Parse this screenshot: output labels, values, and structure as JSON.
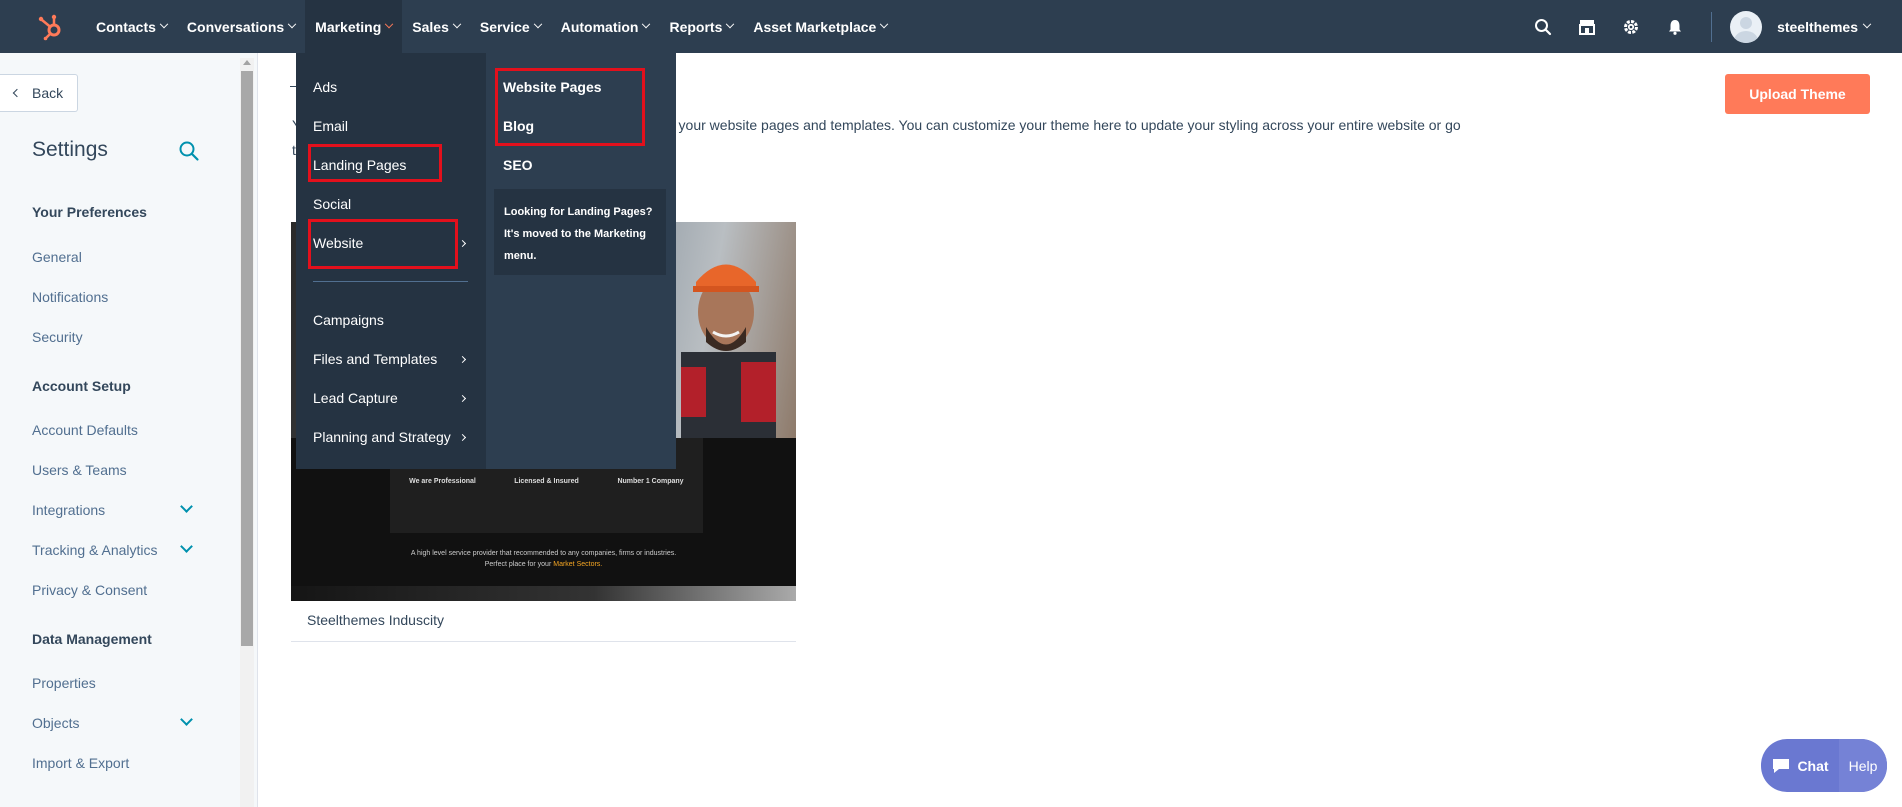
{
  "nav": {
    "items": [
      {
        "label": "Contacts"
      },
      {
        "label": "Conversations"
      },
      {
        "label": "Marketing"
      },
      {
        "label": "Sales"
      },
      {
        "label": "Service"
      },
      {
        "label": "Automation"
      },
      {
        "label": "Reports"
      },
      {
        "label": "Asset Marketplace"
      }
    ],
    "account_name": "steelthemes",
    "icons": [
      "search-icon",
      "marketplace-icon",
      "gear-icon",
      "bell-icon"
    ]
  },
  "sidebar": {
    "back_label": "Back",
    "title": "Settings",
    "sections": {
      "preferences": "Your Preferences",
      "account_setup": "Account Setup",
      "data_management": "Data Management"
    },
    "items": {
      "general": "General",
      "notifications": "Notifications",
      "security": "Security",
      "account_defaults": "Account Defaults",
      "users_teams": "Users & Teams",
      "integrations": "Integrations",
      "tracking": "Tracking & Analytics",
      "privacy": "Privacy & Consent",
      "properties": "Properties",
      "objects": "Objects",
      "import_export": "Import & Export"
    }
  },
  "main": {
    "upload_label": "Upload Theme",
    "desc_lead1": "Y",
    "desc_lead2": "t",
    "description": "r your website pages and templates. You can customize your theme here to update your styling across your entire website or go",
    "theme": {
      "name": "Steelthemes Induscity",
      "features": [
        "We are Professional",
        "Licensed & Insured",
        "Number 1 Company"
      ],
      "tagline_1": "A high level service provider that recommended to any companies, firms or industries.",
      "tagline_2_prefix": "Perfect place for your ",
      "tagline_2_highlight": "Market Sectors."
    }
  },
  "menu": {
    "left": {
      "ads": "Ads",
      "email": "Email",
      "landing_pages": "Landing Pages",
      "social": "Social",
      "website": "Website",
      "campaigns": "Campaigns",
      "files_templates": "Files and Templates",
      "lead_capture": "Lead Capture",
      "planning_strategy": "Planning and Strategy"
    },
    "right": {
      "website_pages": "Website Pages",
      "blog": "Blog",
      "seo": "SEO",
      "note_line1": "Looking for Landing Pages?",
      "note_line2": "It's moved to the Marketing",
      "note_line3": "menu."
    }
  },
  "chat": {
    "chat_label": "Chat",
    "help_label": "Help"
  },
  "colors": {
    "nav_bg": "#2d3e50",
    "accent": "#ff7a59",
    "highlight": "#e3101c",
    "link": "#0091ae",
    "chat": "#6a78d1"
  }
}
